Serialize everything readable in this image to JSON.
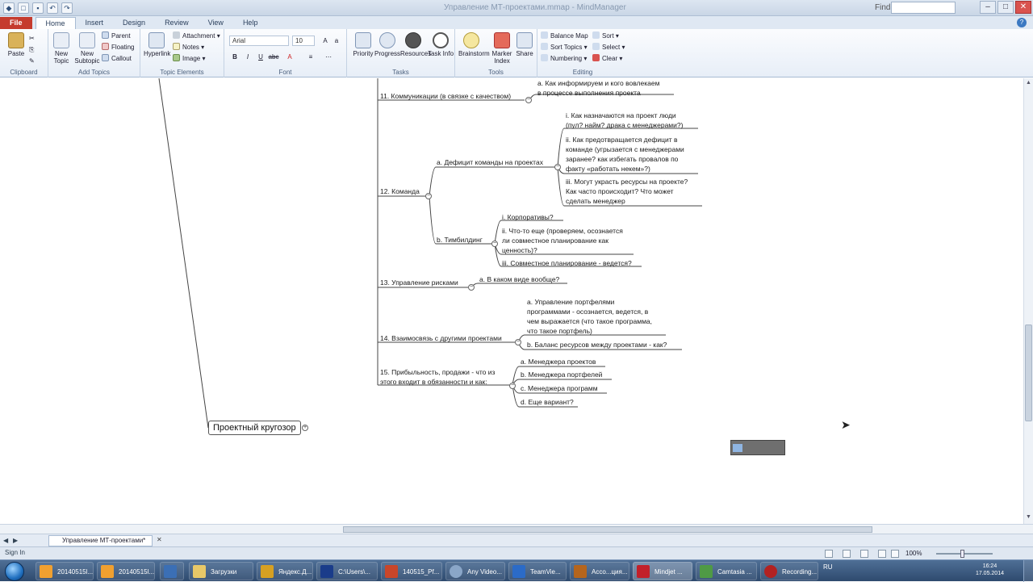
{
  "titlebar": {
    "title": "Управление МТ-проектами.mmap - MindManager",
    "find_label": "Find",
    "find_placeholder": ""
  },
  "ribbon_tabs": [
    "File",
    "Home",
    "Insert",
    "Design",
    "Review",
    "View",
    "Help"
  ],
  "ribbon": {
    "clipboard": {
      "paste": "Paste",
      "label": "Clipboard"
    },
    "add_topics": {
      "new_topic": "New Topic",
      "new_subtopic": "New Subtopic",
      "parent": "Parent",
      "floating": "Floating",
      "callout": "Callout",
      "label": "Add Topics"
    },
    "topic_elements": {
      "hyperlink": "Hyperlink",
      "attachment": "Attachment",
      "notes": "Notes",
      "image": "Image",
      "label": "Topic Elements"
    },
    "font": {
      "name": "Arial",
      "size": "10",
      "label": "Font"
    },
    "tasks": {
      "priority": "Priority",
      "progress": "Progress",
      "resources": "Resources",
      "task_info": "Task Info",
      "label": "Tasks"
    },
    "tools": {
      "brainstorm": "Brainstorm",
      "marker_index": "Marker Index",
      "share": "Share",
      "label": "Tools"
    },
    "editing": {
      "balance_map": "Balance Map",
      "sort": "Sort",
      "sort_topics": "Sort Topics",
      "select": "Select",
      "numbering": "Numbering",
      "clear": "Clear",
      "label": "Editing"
    }
  },
  "map": {
    "central": "Проектный кругозор",
    "n11": "11. Коммуникации (в связке с качеством)",
    "n11a": "a. Как информируем и кого вовлекаем\nв процессе выполнения проекта",
    "n12": "12. Команда",
    "n12a": "a. Дефицит команды на проектах",
    "n12a_i": "i. Как назначаются на проект люди\n(пул? найм? драка с менеджерами?)",
    "n12a_ii": "ii. Как предотвращается дефицит в\nкоманде (угрызается с менеджерами\nзаранее? как избегать провалов по\nфакту «работать некем»?)",
    "n12a_iii": "iii. Могут украсть ресурсы на проекте?\nКак часто происходит? Что может\nсделать менеджер",
    "n12b": "b. Тимбилдинг",
    "n12b_i": "i. Корпоративы?",
    "n12b_ii": "ii. Что-то еще (проверяем, осознается\nли совместное планирование как\nценность)?",
    "n12b_iii": "iii. Совместное планирование - ведется?",
    "n13": "13. Управление рисками",
    "n13a": "a. В каком виде вообще?",
    "n14": "14. Взаимосвязь с другими проектами",
    "n14a": "a. Управление портфелями\nпрограммами - осознается, ведется, в\nчем выражается (что такое программа,\nчто такое портфель)",
    "n14b": "b. Баланс ресурсов между проектами - как?",
    "n15": "15. Прибыльность, продажи - что из\nэтого входит в обязанности и как:",
    "n15a": "a. Менеджера проектов",
    "n15b": "b. Менеджера портфелей",
    "n15c": "c. Менеджера программ",
    "n15d": "d. Еще вариант?"
  },
  "bottom": {
    "doc_tab": "Управление МТ-проектами*",
    "status": "Sign In",
    "zoom": "100%"
  },
  "taskbar": {
    "items": [
      "20140515l...",
      "20140515l...",
      "",
      "Загрузки",
      "Яндекс.Д...",
      "C:\\Users\\...",
      "140515_Pf...",
      "Any Video...",
      "TeamVie...",
      "Acco...ция...",
      "Mindjet ...",
      "Camtasia ...",
      "Recording..."
    ],
    "lang": "RU",
    "time": "16:24",
    "date": "17.05.2014"
  }
}
